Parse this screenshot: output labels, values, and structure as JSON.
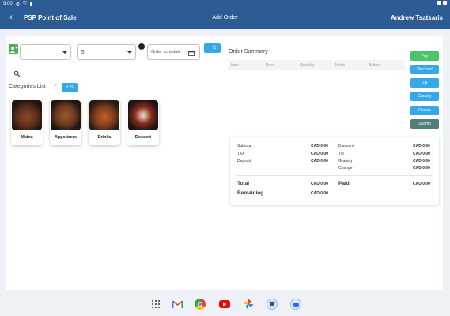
{
  "status_bar": {
    "time": "9:00"
  },
  "app_bar": {
    "back_icon": "arrow-back-icon",
    "app_name": "PSP Point of Sale",
    "screen_title": "Add Order",
    "user_name": "Andrew Tsatsaris"
  },
  "order_form": {
    "customer_icon": "person-add-icon",
    "customer_select_value": "",
    "table_select_value": "S",
    "clock_icon": "clock-icon",
    "schedule_placeholder": "Order schedule",
    "calendar_icon": "calendar-icon",
    "add_customer_label": "+ C",
    "search_icon": "search-icon",
    "categories_label": "Categories List",
    "required_mark": "*",
    "add_category_label": "+ S"
  },
  "categories": [
    {
      "name": "Mains"
    },
    {
      "name": "Appetizers"
    },
    {
      "name": "Drinks"
    },
    {
      "name": "Dessert"
    }
  ],
  "order_summary": {
    "title": "Order Summary",
    "columns": [
      "Item",
      "Price",
      "Quantity",
      "Totals",
      "Action"
    ]
  },
  "actions": {
    "pay": "Pay",
    "discount": "Discount",
    "tip": "Tip",
    "gratuity": "Gratuity",
    "drawer": "Drawer",
    "submit": "Submit"
  },
  "totals": {
    "subtotal_label": "Subtotal",
    "subtotal_value": "CAD 0.00",
    "tax_label": "TAX",
    "tax_value": "CAD 0.00",
    "deposit_label": "Deposit",
    "deposit_value": "CAD 0.00",
    "discount_label": "Discount",
    "discount_value": "CAD 0.00",
    "tip_label": "Tip",
    "tip_value": "CAD 0.00",
    "gratuity_label": "Gratuity",
    "gratuity_value": "CAD 0.00",
    "change_label": "Change",
    "change_value": "CAD 0.00",
    "total_label": "Total",
    "total_value": "CAD 0.00",
    "paid_label": "Paid",
    "paid_value": "CAD 0.00",
    "remaining_label": "Remaining",
    "remaining_value": "CAD 0.00"
  },
  "colors": {
    "appbar": "#2d5b94",
    "accent_blue": "#36a8ea",
    "pay_green": "#4cc46a",
    "submit_teal": "#4f7f77"
  },
  "dock": [
    "apps-grid-icon",
    "gmail-icon",
    "chrome-icon",
    "youtube-icon",
    "photos-icon",
    "phone-icon",
    "messages-icon"
  ]
}
